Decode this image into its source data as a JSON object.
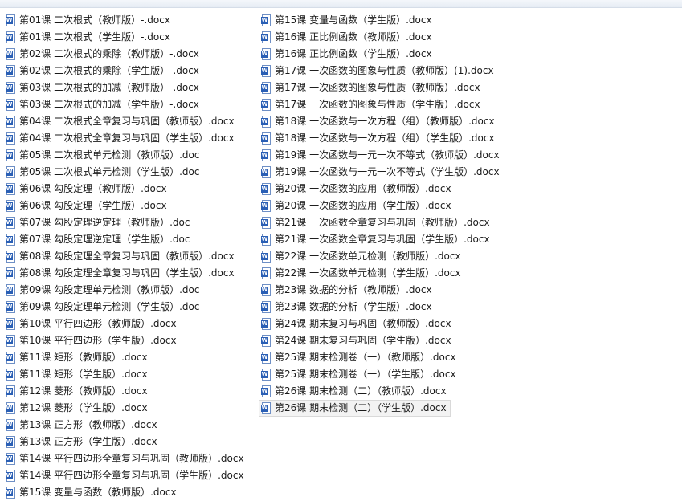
{
  "icon": "word-document-icon",
  "icon_badge": "W",
  "selected_index": 28,
  "left_column": [
    "第01课 二次根式（教师版）-.docx",
    "第01课 二次根式（学生版）-.docx",
    "第02课 二次根式的乘除（教师版）-.docx",
    "第02课 二次根式的乘除（学生版）-.docx",
    "第03课  二次根式的加减（教师版）-.docx",
    "第03课  二次根式的加减（学生版）-.docx",
    "第04课  二次根式全章复习与巩固（教师版）.docx",
    "第04课  二次根式全章复习与巩固（学生版）.docx",
    "第05课  二次根式单元检测（教师版）.doc",
    "第05课  二次根式单元检测（学生版）.doc",
    "第06课  勾股定理（教师版）.docx",
    "第06课  勾股定理（学生版）.docx",
    "第07课  勾股定理逆定理（教师版）.doc",
    "第07课  勾股定理逆定理（学生版）.doc",
    "第08课  勾股定理全章复习与巩固（教师版）.docx",
    "第08课  勾股定理全章复习与巩固（学生版）.docx",
    "第09课  勾股定理单元检测（教师版）.doc",
    "第09课  勾股定理单元检测（学生版）.doc",
    "第10课  平行四边形（教师版）.docx",
    "第10课  平行四边形（学生版）.docx",
    "第11课  矩形（教师版）.docx",
    "第11课  矩形（学生版）.docx",
    "第12课  菱形（教师版）.docx",
    "第12课  菱形（学生版）.docx",
    "第13课  正方形（教师版）.docx",
    "第13课  正方形（学生版）.docx",
    "第14课  平行四边形全章复习与巩固（教师版）.docx",
    "第14课  平行四边形全章复习与巩固（学生版）.docx",
    "第15课 变量与函数（教师版）.docx"
  ],
  "right_column": [
    "第15课 变量与函数（学生版）.docx",
    "第16课  正比例函数（教师版）.docx",
    "第16课  正比例函数（学生版）.docx",
    "第17课  一次函数的图象与性质（教师版）(1).docx",
    "第17课  一次函数的图象与性质（教师版）.docx",
    "第17课  一次函数的图象与性质（学生版）.docx",
    "第18课  一次函数与一次方程（组）（教师版）.docx",
    "第18课  一次函数与一次方程（组）（学生版）.docx",
    "第19课  一次函数与一元一次不等式（教师版）.docx",
    "第19课  一次函数与一元一次不等式（学生版）.docx",
    "第20课  一次函数的应用（教师版）.docx",
    "第20课  一次函数的应用（学生版）.docx",
    "第21课  一次函数全章复习与巩固（教师版）.docx",
    "第21课  一次函数全章复习与巩固（学生版）.docx",
    "第22课  一次函数单元检测（教师版）.docx",
    "第22课  一次函数单元检测（学生版）.docx",
    "第23课  数据的分析（教师版）.docx",
    "第23课  数据的分析（学生版）.docx",
    "第24课  期末复习与巩固（教师版）.docx",
    "第24课  期末复习与巩固（学生版）.docx",
    "第25课  期末检测卷（一）（教师版）.docx",
    "第25课  期末检测卷（一）（学生版）.docx",
    "第26课  期末检测（二）（教师版）.docx",
    "第26课  期末检测（二）（学生版）.docx"
  ]
}
